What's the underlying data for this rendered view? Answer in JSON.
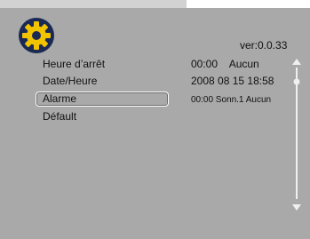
{
  "header": {
    "version_text": "ver:0.0.33",
    "icon": "gear-icon"
  },
  "menu": {
    "items": [
      {
        "label": "Heure d’arrêt",
        "value": "00:00    Aucun"
      },
      {
        "label": "Date/Heure",
        "value": "2008 08 15 18:58"
      },
      {
        "label": "Alarme",
        "value": "00:00 Sonn.1 Aucun",
        "selected": true
      },
      {
        "label": "Défault",
        "value": ""
      }
    ]
  },
  "colors": {
    "panel": "#a9a9a9",
    "tab_strip": "#d2d2d2",
    "gear_yellow": "#f2c400",
    "gear_dark": "#1a2a55",
    "text": "#111111",
    "scrollbar": "#f0f0f0"
  },
  "scrollbar": {
    "up_icon": "triangle-up-icon",
    "down_icon": "triangle-down-icon",
    "thumb_position": 0.0
  }
}
